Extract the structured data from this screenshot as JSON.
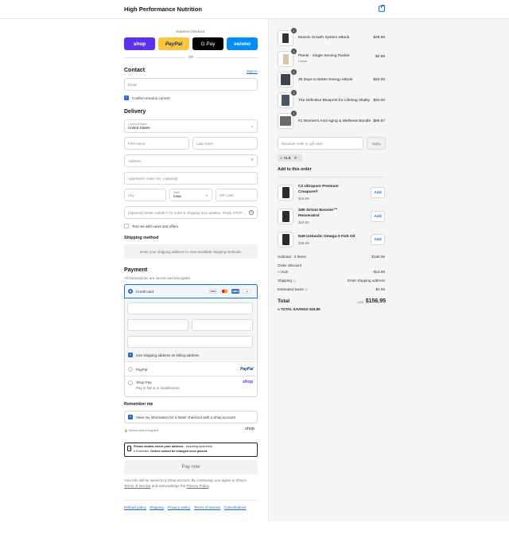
{
  "header": {
    "brand": "High Performance Nutrition",
    "cart_icon": "shopping-bag-icon"
  },
  "express": {
    "title": "Express checkout",
    "buttons": [
      "shop",
      "PayPal",
      "G Pay",
      "venmo"
    ],
    "or_label": "OR"
  },
  "contact": {
    "title": "Contact",
    "sign_in": "Sign in",
    "email_placeholder": "Email",
    "confirm_label": "Confirm email is correct"
  },
  "delivery": {
    "title": "Delivery",
    "country_label": "Country/Region",
    "country_value": "United States",
    "first_name": "First name",
    "last_name": "Last name",
    "address": "Address",
    "apartment": "Apartment, suite, etc. (optional)",
    "city": "City",
    "state_label": "State",
    "state_value": "Iowa",
    "zip": "ZIP code",
    "phone": "(Optional) Enter mobile # for order & shipping text updates. Reply STOP ...",
    "text_me": "Text me with news and offers"
  },
  "shipping": {
    "title": "Shipping method",
    "note": "Enter your shipping address to view available shipping methods."
  },
  "payment": {
    "title": "Payment",
    "subtitle": "All transactions are secure and encrypted.",
    "credit_card": "Credit card",
    "card_brands": [
      "VISA",
      "MC",
      "AMEX",
      "+3"
    ],
    "billing_same": "Use shipping address as billing address",
    "paypal": "PayPal",
    "paypal_logo": "PayPal",
    "shoppay": "Shop Pay",
    "shoppay_sub": "Pay in full or in installments",
    "shoppay_logo": "shop"
  },
  "remember": {
    "title": "Remember me",
    "save_label": "Save my information for a faster checkout with a Shop account",
    "secure": "Secure and encrypted",
    "shop_logo": "shop"
  },
  "notice": {
    "bold_1": "Please double-check your address",
    "text_1": " - including Apartment",
    "text_2": "# if needed.",
    "bold_2": " Orders cannot be changed once placed."
  },
  "pay_now": "Pay now",
  "legal": {
    "text_1": "Your info will be saved to a Shop account. By continuing, you agree to Shop's",
    "terms": "Terms of Service",
    "text_2": " and acknowledge the ",
    "privacy": "Privacy Policy",
    "text_3": "."
  },
  "footer_links": [
    "Refund policy",
    "Shipping",
    "Privacy policy",
    "Terms of service",
    "Cancellations"
  ],
  "cart": {
    "items": [
      {
        "name": "Muscle Growth System eBook",
        "sub": "",
        "price": "$29.99",
        "qty": "1"
      },
      {
        "name": "Plants - Single Serving Packet",
        "sub": "Cacao",
        "price": "$2.99",
        "qty": "1"
      },
      {
        "name": "30 Days to Better Energy eBook",
        "sub": "",
        "price": "$20.00",
        "qty": "1"
      },
      {
        "name": "The Definitive Blueprint for Lifelong Vitality",
        "sub": "",
        "price": "$20.00",
        "qty": "1"
      },
      {
        "name": "#1 Women's Anti-Aging & Wellness Bundle",
        "sub": "",
        "price": "$95.97",
        "qty": "1"
      }
    ],
    "discount_placeholder": "Discount code or gift card",
    "apply": "Apply",
    "code": "HLB",
    "add_title": "Add to this order",
    "upsells": [
      {
        "name_1": "C2 Ultrapure Premium",
        "name_2": "Creapure®",
        "price": "$29.99",
        "add": "Add"
      },
      {
        "name_1": "S90 Sirtuin Booster™",
        "name_2": "Resveratrol",
        "price": "$29.99",
        "add": "Add"
      },
      {
        "name_1": "N49 Icelandic Omega-3 Fish Oil",
        "name_2": "",
        "price": "$39.99",
        "add": "Add"
      }
    ],
    "subtotal_label": "Subtotal · 5 items",
    "subtotal": "$168.95",
    "order_discount": "Order discount",
    "discount_code": "HLB",
    "discount_value": "−$16.89",
    "shipping_label": "Shipping",
    "shipping_value": "Enter shipping address",
    "taxes_label": "Estimated taxes",
    "taxes_value": "$4.89",
    "total_label": "Total",
    "currency": "USD",
    "total": "$156.95",
    "savings_label": "TOTAL SAVINGS",
    "savings": "$16.89"
  }
}
